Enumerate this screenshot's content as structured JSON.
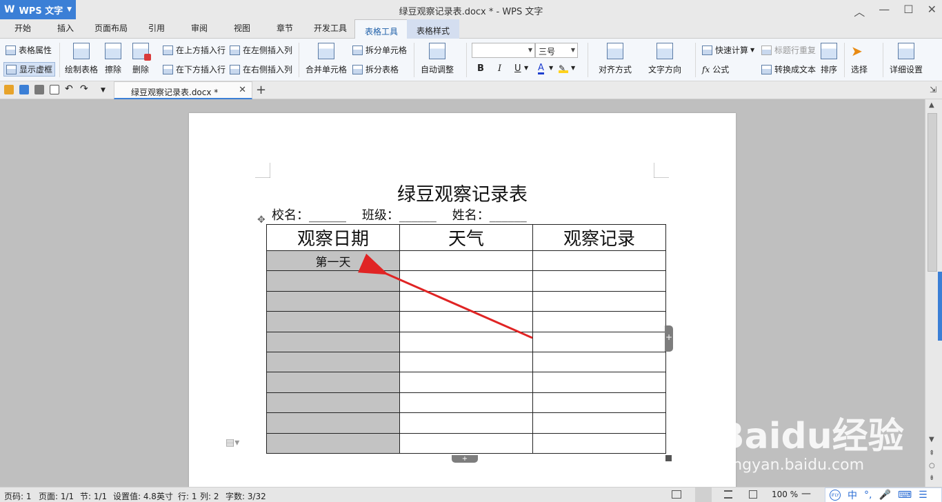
{
  "app": {
    "name": "WPS 文字",
    "logo": "W",
    "window_title": "绿豆观察记录表.docx * - WPS 文字"
  },
  "menu": {
    "tabs": [
      "开始",
      "插入",
      "页面布局",
      "引用",
      "审阅",
      "视图",
      "章节",
      "开发工具",
      "表格工具",
      "表格样式"
    ],
    "active": "表格工具"
  },
  "ribbon": {
    "table_props": "表格属性",
    "show_gridlines": "显示虚框",
    "draw_table": "绘制表格",
    "erase": "擦除",
    "delete": "删除",
    "insert_above": "在上方插入行",
    "insert_below": "在下方插入行",
    "insert_left": "在左侧插入列",
    "insert_right": "在右侧插入列",
    "merge_cells": "合并单元格",
    "split_cells": "拆分单元格",
    "split_table": "拆分表格",
    "autofit": "自动调整",
    "font_name": "",
    "font_size": "三号",
    "bold": "B",
    "italic": "I",
    "underline": "U",
    "font_color": "A",
    "align": "对齐方式",
    "text_direction": "文字方向",
    "quick_calc": "快速计算",
    "formula": "公式",
    "repeat_header": "标题行重复",
    "convert_text": "转换成文本",
    "sort": "排序",
    "select": "选择",
    "details": "详细设置"
  },
  "doc_tab": {
    "label": "绿豆观察记录表.docx *"
  },
  "document": {
    "title": "绿豆观察记录表",
    "info_line": "校名：______    班级：______    姓名：______",
    "table": {
      "headers": [
        "观察日期",
        "天气",
        "观察记录"
      ],
      "first_cell": "第一天",
      "row_count": 10
    }
  },
  "status": {
    "page_code": "页码: 1",
    "page": "页面: 1/1",
    "section": "节: 1/1",
    "setting": "设置值: 4.8英寸",
    "row": "行: 1",
    "col": "列: 2",
    "words": "字数: 3/32",
    "zoom": "100 %"
  },
  "ime": {
    "lang": "中"
  },
  "watermark": {
    "text": "Baidu经验",
    "sub": "jingyan.baidu.com"
  },
  "colors": {
    "accent": "#3b7fd6",
    "selection": "#c3c3c3",
    "arrow": "#e02424"
  }
}
